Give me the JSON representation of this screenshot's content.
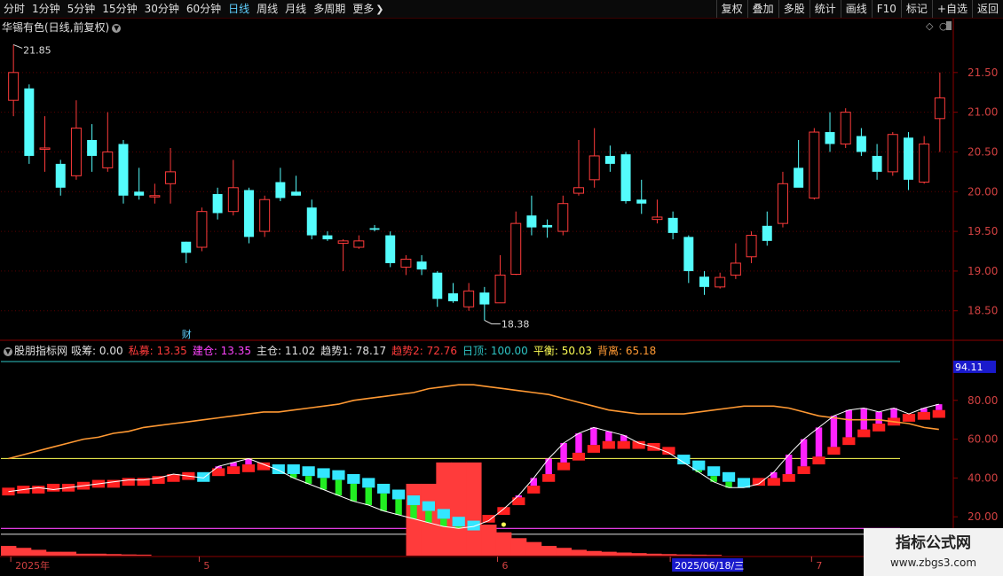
{
  "toolbar": {
    "periods": [
      "分时",
      "1分钟",
      "5分钟",
      "15分钟",
      "30分钟",
      "60分钟",
      "日线",
      "周线",
      "月线",
      "多周期",
      "更多"
    ],
    "active_period": "日线",
    "more_icon": "chevron-right-icon",
    "right_buttons": [
      "复权",
      "叠加",
      "多股",
      "统计",
      "画线",
      "F10",
      "标记",
      "+自选",
      "返回"
    ]
  },
  "main_chart": {
    "title": "华锡有色(日线,前复权)",
    "high_label": "21.85",
    "low_label": "18.38",
    "marker": "财",
    "y_ticks": [
      "21.50",
      "21.00",
      "20.50",
      "20.00",
      "19.50",
      "19.00",
      "18.50"
    ],
    "tick_values": [
      21.5,
      21.0,
      20.5,
      20.0,
      19.5,
      19.0,
      18.5
    ],
    "ylim": [
      18.14,
      22.0
    ],
    "colors": {
      "up": "#ff3b3b",
      "down": "#54fcfc",
      "grid": "#5a0000",
      "border": "#8b0000"
    }
  },
  "indicator": {
    "name": "股朋指标网",
    "items": [
      {
        "label": "吸筹: ",
        "value": "0.00",
        "color": "#e0e0e0"
      },
      {
        "label": "私募: ",
        "value": "13.35",
        "color": "#ff3b3b"
      },
      {
        "label": "建仓: ",
        "value": "13.35",
        "color": "#ff44ff"
      },
      {
        "label": "主仓: ",
        "value": "11.02",
        "color": "#e0e0e0"
      },
      {
        "label": "趋势1: ",
        "value": "78.17",
        "color": "#e0e0e0"
      },
      {
        "label": "趋势2: ",
        "value": "72.76",
        "color": "#ff3b3b"
      },
      {
        "label": "日顶: ",
        "value": "100.00",
        "color": "#2ec4c4"
      },
      {
        "label": "平衡: ",
        "value": "50.03",
        "color": "#ffff55"
      },
      {
        "label": "背离: ",
        "value": "65.18",
        "color": "#ff9933"
      }
    ],
    "y_ticks": [
      "80.00",
      "60.00",
      "40.00",
      "20.00"
    ],
    "tick_values": [
      80,
      60,
      40,
      20
    ],
    "value_badge": "94.11",
    "ylim": [
      0,
      105
    ]
  },
  "date_axis": {
    "labels": [
      {
        "text": "2025年",
        "index": 0
      },
      {
        "text": "5",
        "index": 12
      },
      {
        "text": "6",
        "index": 31
      },
      {
        "text": "2025/06/18/三",
        "index": 42
      },
      {
        "text": "7",
        "index": 51
      }
    ]
  },
  "watermark": {
    "line1": "指标公式网",
    "line2": "www.zbgs3.com"
  },
  "chart_data": [
    {
      "type": "candlestick",
      "title": "华锡有色(日线,前复权)",
      "ylim": [
        18.14,
        22.0
      ],
      "candles": [
        {
          "o": 21.15,
          "h": 21.85,
          "l": 20.95,
          "c": 21.5
        },
        {
          "o": 21.3,
          "h": 21.35,
          "l": 20.35,
          "c": 20.45
        },
        {
          "o": 20.55,
          "h": 20.95,
          "l": 20.25,
          "c": 20.55
        },
        {
          "o": 20.35,
          "h": 20.4,
          "l": 19.95,
          "c": 20.05
        },
        {
          "o": 20.2,
          "h": 21.15,
          "l": 20.15,
          "c": 20.8
        },
        {
          "o": 20.65,
          "h": 20.85,
          "l": 20.25,
          "c": 20.45
        },
        {
          "o": 20.3,
          "h": 21.0,
          "l": 20.25,
          "c": 20.5
        },
        {
          "o": 20.6,
          "h": 20.65,
          "l": 19.85,
          "c": 19.95
        },
        {
          "o": 20.0,
          "h": 20.3,
          "l": 19.9,
          "c": 19.95
        },
        {
          "o": 19.95,
          "h": 20.1,
          "l": 19.85,
          "c": 19.95
        },
        {
          "o": 20.1,
          "h": 20.55,
          "l": 19.85,
          "c": 20.25
        },
        {
          "o": 19.37,
          "h": 19.37,
          "l": 19.1,
          "c": 19.23
        },
        {
          "o": 19.3,
          "h": 19.8,
          "l": 19.25,
          "c": 19.75
        },
        {
          "o": 19.97,
          "h": 20.05,
          "l": 19.65,
          "c": 19.73
        },
        {
          "o": 19.75,
          "h": 20.4,
          "l": 19.7,
          "c": 20.05
        },
        {
          "o": 20.02,
          "h": 20.05,
          "l": 19.35,
          "c": 19.43
        },
        {
          "o": 19.5,
          "h": 19.95,
          "l": 19.43,
          "c": 19.9
        },
        {
          "o": 20.12,
          "h": 20.3,
          "l": 19.88,
          "c": 19.92
        },
        {
          "o": 20.0,
          "h": 20.2,
          "l": 19.95,
          "c": 19.95
        },
        {
          "o": 19.8,
          "h": 19.9,
          "l": 19.4,
          "c": 19.45
        },
        {
          "o": 19.45,
          "h": 19.5,
          "l": 19.38,
          "c": 19.4
        },
        {
          "o": 19.35,
          "h": 19.4,
          "l": 19.0,
          "c": 19.38
        },
        {
          "o": 19.3,
          "h": 19.45,
          "l": 19.28,
          "c": 19.38
        },
        {
          "o": 19.54,
          "h": 19.58,
          "l": 19.5,
          "c": 19.52
        },
        {
          "o": 19.45,
          "h": 19.5,
          "l": 19.05,
          "c": 19.1
        },
        {
          "o": 19.05,
          "h": 19.2,
          "l": 18.95,
          "c": 19.15
        },
        {
          "o": 19.12,
          "h": 19.2,
          "l": 18.95,
          "c": 19.02
        },
        {
          "o": 18.98,
          "h": 19.0,
          "l": 18.55,
          "c": 18.65
        },
        {
          "o": 18.72,
          "h": 18.85,
          "l": 18.6,
          "c": 18.62
        },
        {
          "o": 18.55,
          "h": 18.85,
          "l": 18.5,
          "c": 18.75
        },
        {
          "o": 18.73,
          "h": 18.8,
          "l": 18.38,
          "c": 18.58
        },
        {
          "o": 18.6,
          "h": 19.2,
          "l": 18.6,
          "c": 18.95
        },
        {
          "o": 18.96,
          "h": 19.75,
          "l": 18.95,
          "c": 19.6
        },
        {
          "o": 19.7,
          "h": 19.95,
          "l": 19.45,
          "c": 19.55
        },
        {
          "o": 19.58,
          "h": 19.65,
          "l": 19.42,
          "c": 19.55
        },
        {
          "o": 19.5,
          "h": 19.95,
          "l": 19.45,
          "c": 19.85
        },
        {
          "o": 19.98,
          "h": 20.65,
          "l": 19.95,
          "c": 20.05
        },
        {
          "o": 20.15,
          "h": 20.8,
          "l": 20.05,
          "c": 20.45
        },
        {
          "o": 20.45,
          "h": 20.58,
          "l": 20.25,
          "c": 20.35
        },
        {
          "o": 20.47,
          "h": 20.5,
          "l": 19.85,
          "c": 19.88
        },
        {
          "o": 19.9,
          "h": 20.15,
          "l": 19.72,
          "c": 19.85
        },
        {
          "o": 19.65,
          "h": 19.9,
          "l": 19.6,
          "c": 19.68
        },
        {
          "o": 19.67,
          "h": 19.75,
          "l": 19.4,
          "c": 19.48
        },
        {
          "o": 19.43,
          "h": 19.45,
          "l": 18.85,
          "c": 19.0
        },
        {
          "o": 18.93,
          "h": 19.0,
          "l": 18.7,
          "c": 18.8
        },
        {
          "o": 18.8,
          "h": 18.98,
          "l": 18.78,
          "c": 18.92
        },
        {
          "o": 18.95,
          "h": 19.35,
          "l": 18.9,
          "c": 19.1
        },
        {
          "o": 19.18,
          "h": 19.5,
          "l": 19.1,
          "c": 19.45
        },
        {
          "o": 19.57,
          "h": 19.75,
          "l": 19.32,
          "c": 19.38
        },
        {
          "o": 19.6,
          "h": 20.25,
          "l": 19.55,
          "c": 20.1
        },
        {
          "o": 20.3,
          "h": 20.65,
          "l": 20.2,
          "c": 20.05
        },
        {
          "o": 19.92,
          "h": 20.8,
          "l": 19.9,
          "c": 20.75
        },
        {
          "o": 20.75,
          "h": 21.0,
          "l": 20.5,
          "c": 20.6
        },
        {
          "o": 20.6,
          "h": 21.05,
          "l": 20.55,
          "c": 21.0
        },
        {
          "o": 20.7,
          "h": 20.8,
          "l": 20.45,
          "c": 20.5
        },
        {
          "o": 20.45,
          "h": 20.6,
          "l": 20.15,
          "c": 20.25
        },
        {
          "o": 20.25,
          "h": 20.75,
          "l": 20.2,
          "c": 20.72
        },
        {
          "o": 20.68,
          "h": 20.75,
          "l": 20.02,
          "c": 20.15
        },
        {
          "o": 20.12,
          "h": 20.7,
          "l": 20.1,
          "c": 20.6
        },
        {
          "o": 20.92,
          "h": 21.5,
          "l": 20.5,
          "c": 21.18
        }
      ]
    },
    {
      "type": "line",
      "title": "股朋指标网",
      "ylim": [
        0,
        105
      ],
      "series": [
        {
          "name": "趋势1",
          "color": "#ffffff",
          "values": [
            33,
            34,
            35,
            34,
            35,
            36,
            37,
            38,
            39,
            39,
            40,
            42,
            41,
            40,
            46,
            48,
            50,
            47,
            44,
            40,
            37,
            34,
            31,
            28,
            26,
            23,
            21,
            19,
            17,
            15,
            14,
            15,
            18,
            24,
            31,
            40,
            50,
            58,
            63,
            66,
            64,
            62,
            58,
            56,
            53,
            48,
            43,
            38,
            35,
            35,
            37,
            43,
            52,
            60,
            66,
            72,
            75,
            76,
            74,
            76,
            73,
            76,
            78
          ]
        },
        {
          "name": "趋势2",
          "color": "#ff3b3b",
          "values": [
            32,
            33,
            33,
            34,
            34,
            35,
            36,
            36,
            37,
            37,
            38,
            39,
            40,
            41,
            42,
            43,
            44,
            45,
            45,
            45,
            44,
            43,
            42,
            40,
            38,
            35,
            32,
            29,
            26,
            22,
            18,
            16,
            18,
            22,
            27,
            33,
            39,
            45,
            50,
            54,
            56,
            56,
            56,
            55,
            53,
            50,
            47,
            44,
            41,
            38,
            37,
            37,
            39,
            43,
            48,
            53,
            58,
            62,
            65,
            68,
            70,
            71,
            72
          ]
        },
        {
          "name": "背离",
          "color": "#ff9933",
          "values": [
            50,
            52,
            54,
            56,
            58,
            60,
            61,
            63,
            64,
            66,
            67,
            68,
            69,
            70,
            71,
            72,
            73,
            74,
            74,
            75,
            76,
            77,
            78,
            80,
            81,
            82,
            83,
            84,
            86,
            87,
            88,
            88,
            87,
            86,
            85,
            84,
            83,
            81,
            79,
            77,
            75,
            74,
            73,
            73,
            73,
            73,
            74,
            75,
            76,
            77,
            77,
            77,
            76,
            74,
            72,
            71,
            70,
            70,
            70,
            69,
            68,
            66,
            65
          ]
        },
        {
          "name": "平衡",
          "color": "#ffff55",
          "values": [
            50.03
          ]
        },
        {
          "name": "日顶",
          "color": "#2ec4c4",
          "values": [
            100
          ]
        },
        {
          "name": "私募",
          "color": "#ff3b3b",
          "values": [
            0,
            0,
            0,
            0,
            0,
            0,
            0,
            0,
            0,
            0,
            0,
            0,
            0,
            0,
            0,
            0,
            0,
            0,
            0,
            0,
            0,
            0,
            0,
            0,
            0,
            0,
            0,
            37,
            37,
            48,
            48,
            48,
            0,
            0,
            0,
            0,
            0,
            0,
            0,
            0,
            0,
            0,
            0,
            0,
            0,
            0,
            0,
            0,
            0,
            0,
            0,
            0,
            0,
            0,
            0,
            0,
            0,
            0,
            0,
            0,
            0,
            0,
            0
          ]
        }
      ]
    }
  ]
}
